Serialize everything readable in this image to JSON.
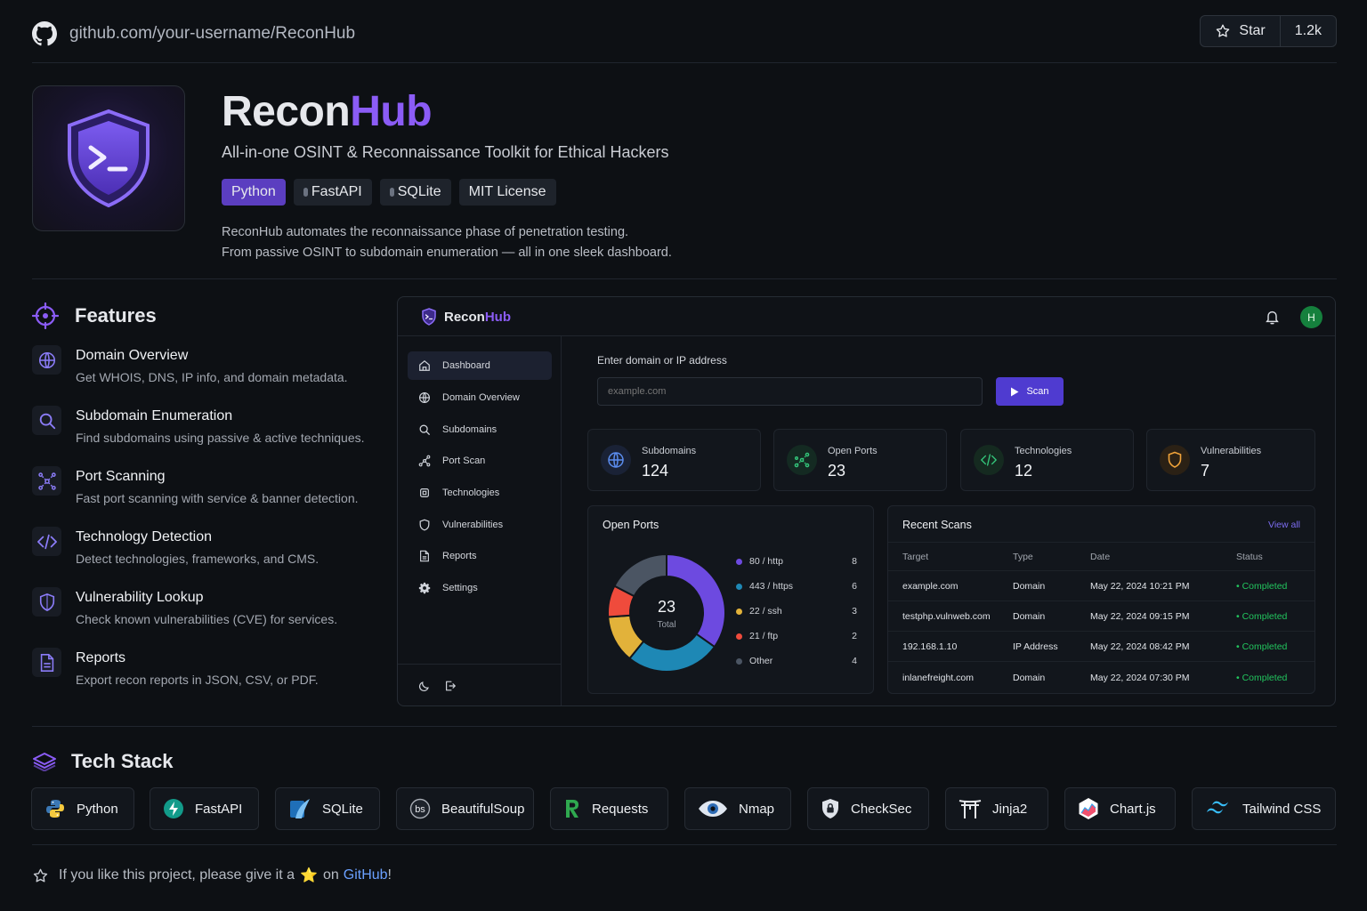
{
  "repo": {
    "url": "github.com/your-username/ReconHub",
    "star_label": "Star",
    "star_count": "1.2k"
  },
  "hero": {
    "title_part1": "Recon",
    "title_part2": "Hub",
    "subtitle": "All-in-one OSINT & Reconnaissance Toolkit for Ethical Hackers",
    "badges": [
      "Python",
      "FastAPI",
      "SQLite",
      "MIT License"
    ],
    "desc_line1": "ReconHub automates the reconnaissance phase of penetration testing.",
    "desc_line2": "From passive OSINT to subdomain enumeration — all in one sleek dashboard."
  },
  "features": {
    "heading": "Features",
    "items": [
      {
        "title": "Domain Overview",
        "desc": "Get WHOIS, DNS, IP info, and domain metadata.",
        "icon": "globe-icon"
      },
      {
        "title": "Subdomain Enumeration",
        "desc": "Find subdomains using passive & active techniques.",
        "icon": "search-icon"
      },
      {
        "title": "Port Scanning",
        "desc": "Fast port scanning with service & banner detection.",
        "icon": "network-icon"
      },
      {
        "title": "Technology Detection",
        "desc": "Detect technologies, frameworks, and CMS.",
        "icon": "code-icon"
      },
      {
        "title": "Vulnerability Lookup",
        "desc": "Check known vulnerabilities (CVE) for services.",
        "icon": "shield-icon"
      },
      {
        "title": "Reports",
        "desc": "Export recon reports in JSON, CSV, or PDF.",
        "icon": "document-icon"
      }
    ]
  },
  "dashboard": {
    "brand_part1": "Recon",
    "brand_part2": "Hub",
    "avatar_initial": "H",
    "nav": [
      "Dashboard",
      "Domain Overview",
      "Subdomains",
      "Port Scan",
      "Technologies",
      "Vulnerabilities",
      "Reports",
      "Settings"
    ],
    "scan_label": "Enter domain or IP address",
    "scan_placeholder": "example.com",
    "scan_button": "Scan",
    "stats": [
      {
        "label": "Subdomains",
        "value": "124"
      },
      {
        "label": "Open Ports",
        "value": "23"
      },
      {
        "label": "Technologies",
        "value": "12"
      },
      {
        "label": "Vulnerabilities",
        "value": "7"
      }
    ],
    "open_ports_title": "Open Ports",
    "donut_total": "23",
    "donut_total_label": "Total",
    "recent_title": "Recent Scans",
    "view_all": "View all",
    "table_headers": [
      "Target",
      "Type",
      "Date",
      "Status"
    ],
    "scans": [
      {
        "target": "example.com",
        "type": "Domain",
        "date": "May 22, 2024 10:21 PM",
        "status": "Completed"
      },
      {
        "target": "testphp.vulnweb.com",
        "type": "Domain",
        "date": "May 22, 2024 09:15 PM",
        "status": "Completed"
      },
      {
        "target": "192.168.1.10",
        "type": "IP Address",
        "date": "May 22, 2024 08:42 PM",
        "status": "Completed"
      },
      {
        "target": "inlanefreight.com",
        "type": "Domain",
        "date": "May 22, 2024 07:30 PM",
        "status": "Completed"
      }
    ]
  },
  "chart_data": {
    "type": "pie",
    "categories": [
      "80 / http",
      "443 / https",
      "22 / ssh",
      "21 / ftp",
      "Other"
    ],
    "values": [
      8,
      6,
      3,
      2,
      4
    ],
    "colors": [
      "#6d4ae0",
      "#1e88b5",
      "#e2b23a",
      "#ef4b3c",
      "#4b5563"
    ],
    "title": "Open Ports"
  },
  "tech_stack": {
    "heading": "Tech Stack",
    "items": [
      "Python",
      "FastAPI",
      "SQLite",
      "BeautifulSoup",
      "Requests",
      "Nmap",
      "CheckSec",
      "Jinja2",
      "Chart.js",
      "Tailwind CSS"
    ]
  },
  "footer": {
    "before": "If you like this project, please give it a",
    "star_emoji": "⭐",
    "middle": "on",
    "link": "GitHub",
    "after": "!"
  },
  "colors": {
    "accent": "#8b5cf6",
    "background": "#0d1014",
    "success": "#22c55e"
  }
}
